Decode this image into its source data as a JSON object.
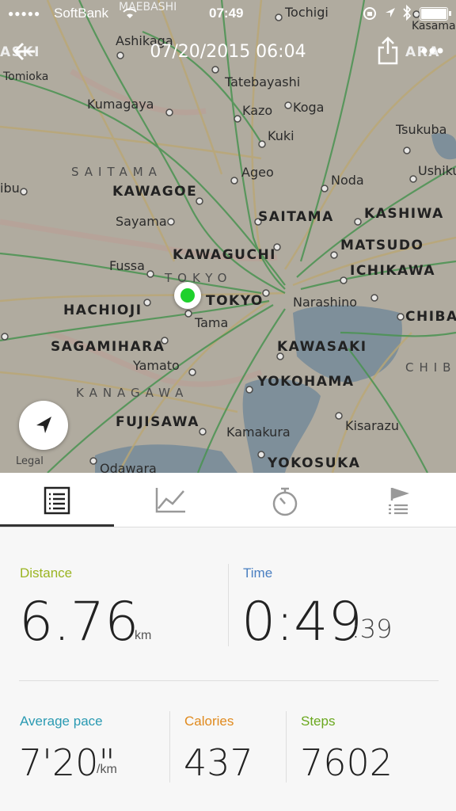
{
  "status_bar": {
    "carrier": "SoftBank",
    "time": "07:49"
  },
  "nav": {
    "title": "07/20/2015 06:04"
  },
  "map": {
    "legal": "Legal",
    "labels": [
      "Tochigi",
      "Kasama",
      "Ashikaga",
      "Tomioka",
      "Tatebayashi",
      "Kumagaya",
      "Kazo",
      "Koga",
      "Tsukuba",
      "Kuki",
      "Ushiku",
      "Ageo",
      "Noda",
      "KAWAGOE",
      "SAITAMA",
      "KASHIWA",
      "Sayama",
      "MATSUDO",
      "KAWAGUCHI",
      "Fussa",
      "ICHIKAWA",
      "TOKYO",
      "Narashino",
      "HACHIOJI",
      "Tama",
      "CHIBA",
      "SAGAMIHARA",
      "KAWASAKI",
      "Yamato",
      "YOKOHAMA",
      "FUJISAWA",
      "Kisarazu",
      "Kamakura",
      "YOKOSUKA",
      "Odawara",
      "SAITAMA",
      "TOKYO",
      "KANAGAWA",
      "CHIB",
      "ibu",
      "MAEBASHI",
      "ASKI",
      "ARA"
    ],
    "marker_color": "#1fd12c"
  },
  "tabs": [
    {
      "name": "summary",
      "icon": "list-icon",
      "selected": true
    },
    {
      "name": "graph",
      "icon": "graph-icon",
      "selected": false
    },
    {
      "name": "laps",
      "icon": "stopwatch-icon",
      "selected": false
    },
    {
      "name": "splits",
      "icon": "flag-list-icon",
      "selected": false
    }
  ],
  "stats": {
    "distance": {
      "label": "Distance",
      "value": "6.76",
      "unit": "km",
      "color": "#9ab421"
    },
    "time": {
      "label": "Time",
      "value": "0:49",
      "seconds": ":39",
      "color": "#4a7fc1"
    },
    "pace": {
      "label": "Average pace",
      "value": "7'20\"",
      "unit": "/km",
      "color": "#2a9ab2"
    },
    "calories": {
      "label": "Calories",
      "value": "437",
      "color": "#e08a1e"
    },
    "steps": {
      "label": "Steps",
      "value": "7602",
      "color": "#6aa81e"
    }
  }
}
